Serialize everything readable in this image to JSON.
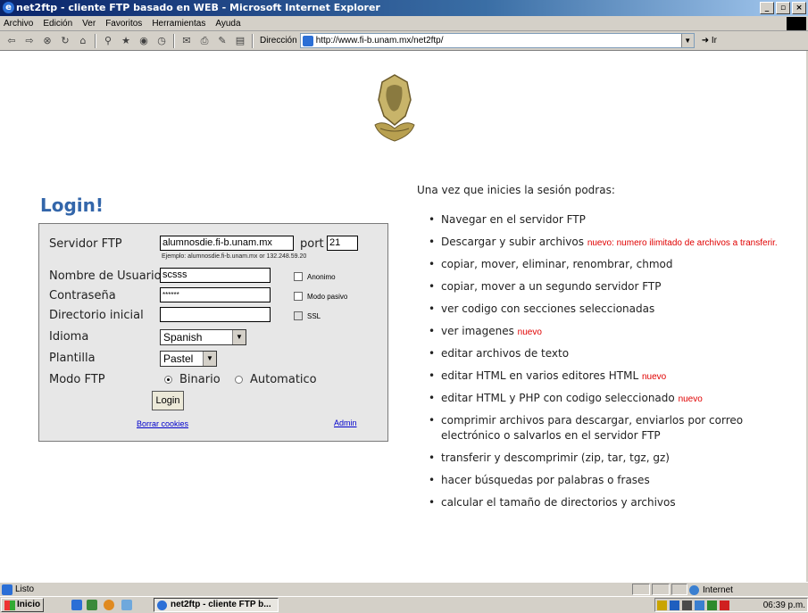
{
  "window": {
    "title": "net2ftp - cliente FTP basado en WEB - Microsoft Internet Explorer",
    "buttons": [
      "_",
      "▫",
      "×"
    ]
  },
  "menu": [
    "Archivo",
    "Edición",
    "Ver",
    "Favoritos",
    "Herramientas",
    "Ayuda"
  ],
  "toolbar": {
    "address_label": "Dirección",
    "address_value": "http://www.fi-b.unam.mx/net2ftp/",
    "go_label": "Ir"
  },
  "login": {
    "title": "Login!",
    "server_label": "Servidor FTP",
    "server_value": "alumnosdie.fi-b.unam.mx",
    "port_label": "port",
    "port_value": "21",
    "server_hint": "Ejemplo: alumnosdie.fi-b.unam.mx or 132.248.59.20",
    "user_label": "Nombre de Usuario",
    "user_value": "scsss",
    "anon_label": "Anonimo",
    "password_label": "Contraseña",
    "password_value": "******",
    "passive_label": "Modo pasivo",
    "dir_label": "Directorio inicial",
    "dir_value": "",
    "ssl_label": "SSL",
    "lang_label": "Idioma",
    "lang_value": "Spanish",
    "skin_label": "Plantilla",
    "skin_value": "Pastel",
    "ftpmode_label": "Modo FTP",
    "mode_binary": "Binario",
    "mode_auto": "Automatico",
    "login_button": "Login",
    "clear_cookies": "Borrar cookies",
    "admin": "Admin"
  },
  "features": {
    "intro": "Una vez que inicies la sesión podras:",
    "items": [
      {
        "text": "Navegar en el servidor FTP",
        "new": ""
      },
      {
        "text": "Descargar y subir archivos ",
        "new": "nuevo: numero ilimitado de archivos a transferir."
      },
      {
        "text": "copiar, mover, eliminar, renombrar, chmod",
        "new": ""
      },
      {
        "text": "copiar, mover a un segundo servidor FTP",
        "new": ""
      },
      {
        "text": "ver codigo con secciones seleccionadas",
        "new": ""
      },
      {
        "text": "ver imagenes ",
        "new": "nuevo"
      },
      {
        "text": "editar archivos de texto",
        "new": ""
      },
      {
        "text": "editar HTML en varios editores HTML ",
        "new": "nuevo"
      },
      {
        "text": "editar HTML y PHP con codigo seleccionado ",
        "new": "nuevo"
      },
      {
        "text": "comprimir archivos para descargar, enviarlos por correo electrónico o salvarlos en el servidor FTP",
        "new": ""
      },
      {
        "text": "transferir y descomprimir (zip, tar, tgz, gz)",
        "new": ""
      },
      {
        "text": "hacer búsquedas por palabras o frases",
        "new": ""
      },
      {
        "text": "calcular el tamaño de directorios y archivos",
        "new": ""
      }
    ]
  },
  "status": {
    "ready": "Listo",
    "zone": "Internet"
  },
  "taskbar": {
    "start": "Inicio",
    "task": "net2ftp - cliente FTP b...",
    "clock": "06:39 p.m."
  }
}
